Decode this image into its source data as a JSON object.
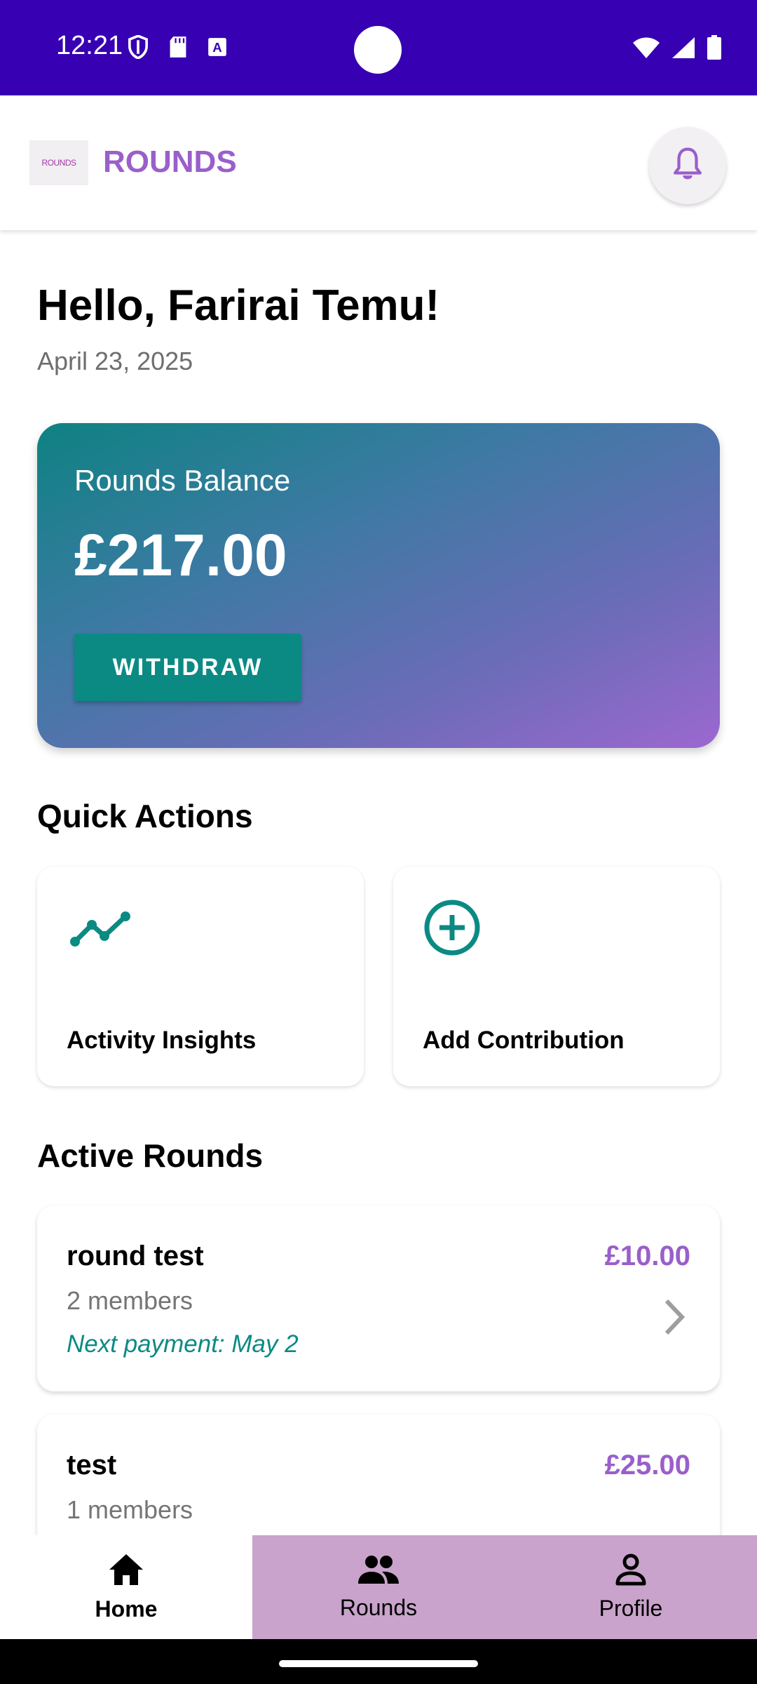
{
  "status_bar": {
    "time": "12:21",
    "icons_left": [
      "shield-icon",
      "sd-card-icon",
      "text-a-icon"
    ],
    "icons_right": [
      "wifi-icon",
      "signal-icon",
      "battery-icon"
    ]
  },
  "app_bar": {
    "logo_text": "ROUNDS",
    "title": "ROUNDS",
    "accent_color": "#9a5fcb",
    "notification_icon": "bell-icon"
  },
  "greeting": {
    "title": "Hello, Farirai Temu!",
    "date": "April 23, 2025"
  },
  "balance_card": {
    "label": "Rounds Balance",
    "amount": "£217.00",
    "withdraw_label": "WITHDRAW",
    "gradient_colors": [
      "#0e8282",
      "#9c68d0"
    ]
  },
  "quick_actions": {
    "title": "Quick Actions",
    "items": [
      {
        "label": "Activity Insights",
        "icon": "trend-line-icon"
      },
      {
        "label": "Add Contribution",
        "icon": "add-circle-icon"
      }
    ]
  },
  "active_rounds": {
    "title": "Active Rounds",
    "items": [
      {
        "name": "round test",
        "amount": "£10.00",
        "members": "2 members",
        "next_payment": "Next payment: May 2"
      },
      {
        "name": "test",
        "amount": "£25.00",
        "members": "1 members"
      }
    ]
  },
  "bottom_nav": {
    "items": [
      {
        "label": "Home",
        "icon": "home-icon",
        "selected": true
      },
      {
        "label": "Rounds",
        "icon": "group-icon",
        "selected": false
      },
      {
        "label": "Profile",
        "icon": "person-icon",
        "selected": false
      }
    ],
    "inactive_bg": "#c9a3cb"
  }
}
